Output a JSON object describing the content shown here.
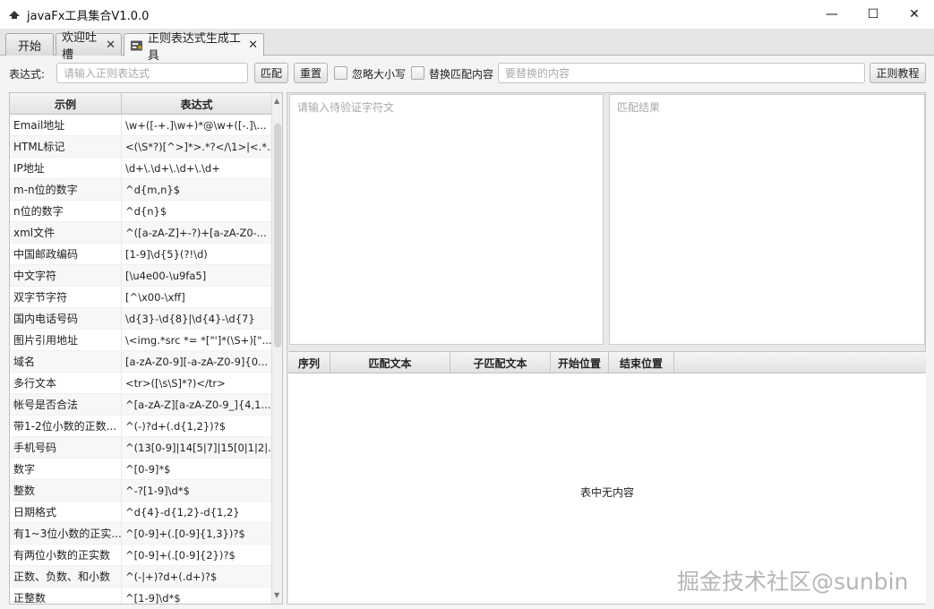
{
  "window": {
    "title": "javaFx工具集合V1.0.0",
    "min_glyph": "—",
    "max_glyph": "☐",
    "close_glyph": "✕"
  },
  "tabs": [
    {
      "label": "开始"
    },
    {
      "label": "欢迎吐槽",
      "close": "✕"
    },
    {
      "label": "正则表达式生成工具",
      "close": "✕",
      "selected": true
    }
  ],
  "toolbar": {
    "expr_label": "表达式:",
    "expr_placeholder": "请输入正则表达式",
    "match_label": "匹配",
    "reset_label": "重置",
    "ignore_case_label": "忽略大小写",
    "ignore_case_checked": false,
    "replace_label": "替换匹配内容",
    "replace_checked": false,
    "replace_placeholder": "要替换的内容",
    "tutorial_label": "正则教程"
  },
  "examples_table": {
    "headers": [
      "示例",
      "表达式"
    ],
    "rows": [
      [
        "Email地址",
        "\\w+([-+.]\\w+)*@\\w+([-.]\\..."
      ],
      [
        "HTML标记",
        "<(\\S*?)[^>]*>.*?</\\1>|<.*..."
      ],
      [
        "IP地址",
        "\\d+\\.\\d+\\.\\d+\\.\\d+"
      ],
      [
        "m-n位的数字",
        "^d{m,n}$"
      ],
      [
        "n位的数字",
        "^d{n}$"
      ],
      [
        "xml文件",
        "^([a-zA-Z]+-?)+[a-zA-Z0-..."
      ],
      [
        "中国邮政编码",
        "[1-9]\\d{5}(?!\\d)"
      ],
      [
        "中文字符",
        "[\\u4e00-\\u9fa5]"
      ],
      [
        "双字节字符",
        "[^\\x00-\\xff]"
      ],
      [
        "国内电话号码",
        "\\d{3}-\\d{8}|\\d{4}-\\d{7}"
      ],
      [
        "图片引用地址",
        "\\<img.*src *= *[\"']*(\\S+)[\"..."
      ],
      [
        "域名",
        "[a-zA-Z0-9][-a-zA-Z0-9]{0..."
      ],
      [
        "多行文本",
        "<tr>([\\s\\S]*?)</tr>"
      ],
      [
        "帐号是否合法",
        "^[a-zA-Z][a-zA-Z0-9_]{4,1..."
      ],
      [
        "带1-2位小数的正数...",
        "^(-)?d+(.d{1,2})?$"
      ],
      [
        "手机号码",
        "^(13[0-9]|14[5|7]|15[0|1|2|..."
      ],
      [
        "数字",
        "^[0-9]*$"
      ],
      [
        "整数",
        "^-?[1-9]\\d*$"
      ],
      [
        "日期格式",
        "^d{4}-d{1,2}-d{1,2}"
      ],
      [
        "有1~3位小数的正实...",
        "^[0-9]+(.[0-9]{1,3})?$"
      ],
      [
        "有两位小数的正实数",
        "^[0-9]+(.[0-9]{2})?$"
      ],
      [
        "正数、负数、和小数",
        "^(-|+)?d+(.d+)?$"
      ],
      [
        "正整数",
        "^[1-9]\\d*$"
      ]
    ]
  },
  "source_placeholder": "请输入待验证字符文",
  "result_placeholder": "匹配结果",
  "results_table": {
    "headers": [
      "序列",
      "匹配文本",
      "子匹配文本",
      "开始位置",
      "结束位置"
    ],
    "empty_text": "表中无内容"
  },
  "watermark": "掘金技术社区@sunbin"
}
